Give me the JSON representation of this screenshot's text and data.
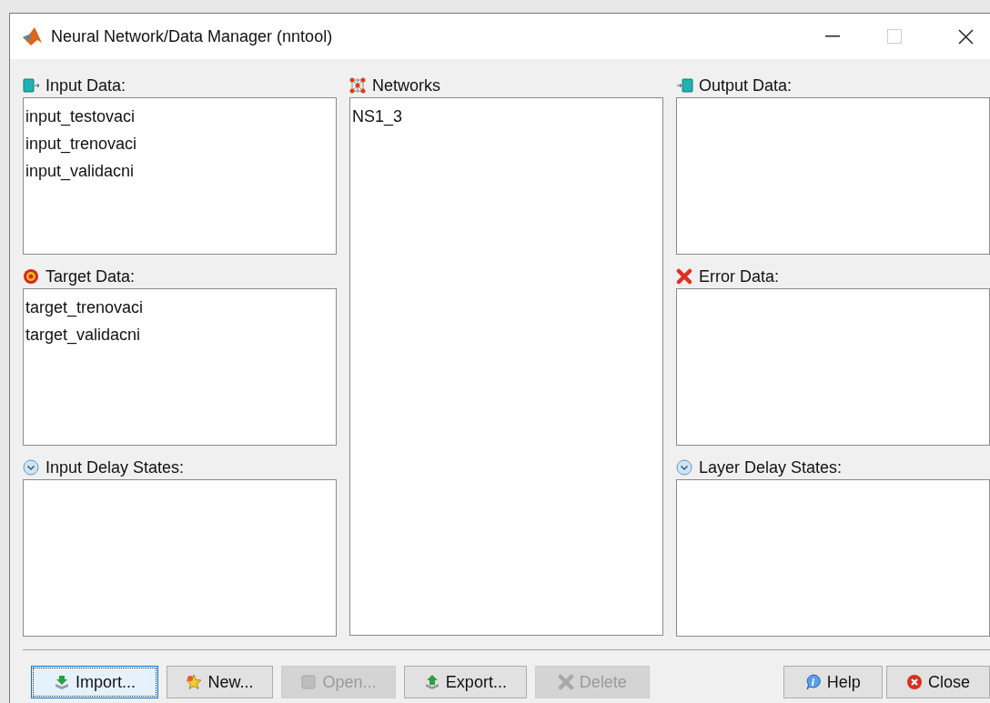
{
  "window": {
    "title": "Neural Network/Data Manager (nntool)"
  },
  "columns": [
    {
      "panels": [
        {
          "kind": "input",
          "label": "Input Data:",
          "items": [
            "input_testovaci",
            "input_trenovaci",
            "input_validacni"
          ]
        },
        {
          "kind": "target",
          "label": "Target Data:",
          "items": [
            "target_trenovaci",
            "target_validacni"
          ]
        },
        {
          "kind": "delay",
          "label": "Input Delay States:"
        }
      ]
    },
    {
      "panels": [
        {
          "kind": "network",
          "label": "Networks",
          "items": [
            "NS1_3"
          ]
        }
      ]
    },
    {
      "panels": [
        {
          "kind": "output",
          "label": "Output Data:"
        },
        {
          "kind": "error",
          "label": "Error Data:"
        },
        {
          "kind": "delay",
          "label": "Layer Delay States:"
        }
      ]
    }
  ],
  "buttons": [
    {
      "kind": "import",
      "label": "Import...",
      "disabled": false,
      "focused": true
    },
    {
      "kind": "new",
      "label": "New...",
      "disabled": false,
      "focused": false
    },
    {
      "kind": "open",
      "label": "Open...",
      "disabled": true,
      "focused": false
    },
    {
      "kind": "export",
      "label": "Export...",
      "disabled": false,
      "focused": false
    },
    {
      "kind": "delete",
      "label": "Delete",
      "disabled": true,
      "focused": false
    },
    {
      "kind": "help",
      "label": "Help",
      "disabled": false,
      "focused": false
    },
    {
      "kind": "close",
      "label": "Close",
      "disabled": false,
      "focused": false
    }
  ]
}
